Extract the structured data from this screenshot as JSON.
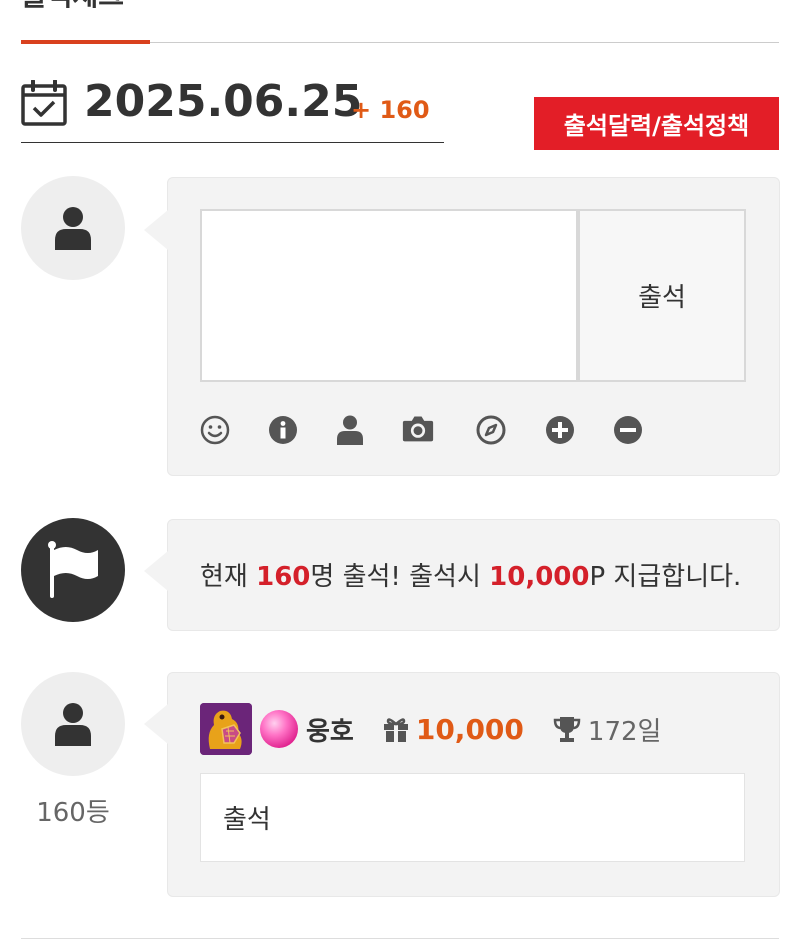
{
  "header": {
    "title": "출석체크"
  },
  "date_row": {
    "date": "2025.06.25",
    "plus_count": "+ 160",
    "calendar_icon": "calendar-check-icon"
  },
  "policy_button": {
    "label": "출석달력/출석정책"
  },
  "comment_form": {
    "textarea_value": "",
    "submit_label": "출석",
    "toolbar_icons": [
      "smile-icon",
      "info-icon",
      "user-icon",
      "camera-icon",
      "compass-icon",
      "plus-circle-icon",
      "minus-circle-icon"
    ]
  },
  "notice": {
    "prefix": "현재 ",
    "count": "160",
    "middle": "명 출석! 출석시 ",
    "points": "10,000",
    "suffix": "P 지급합니다."
  },
  "entry": {
    "rank": "160등",
    "nickname": "웅호",
    "points": "10,000",
    "days": "172일",
    "message": "출석"
  },
  "colors": {
    "accent_red": "#e31e27",
    "highlight_red": "#d4202a",
    "orange": "#e05a16",
    "panel_bg": "#f3f3f3"
  }
}
